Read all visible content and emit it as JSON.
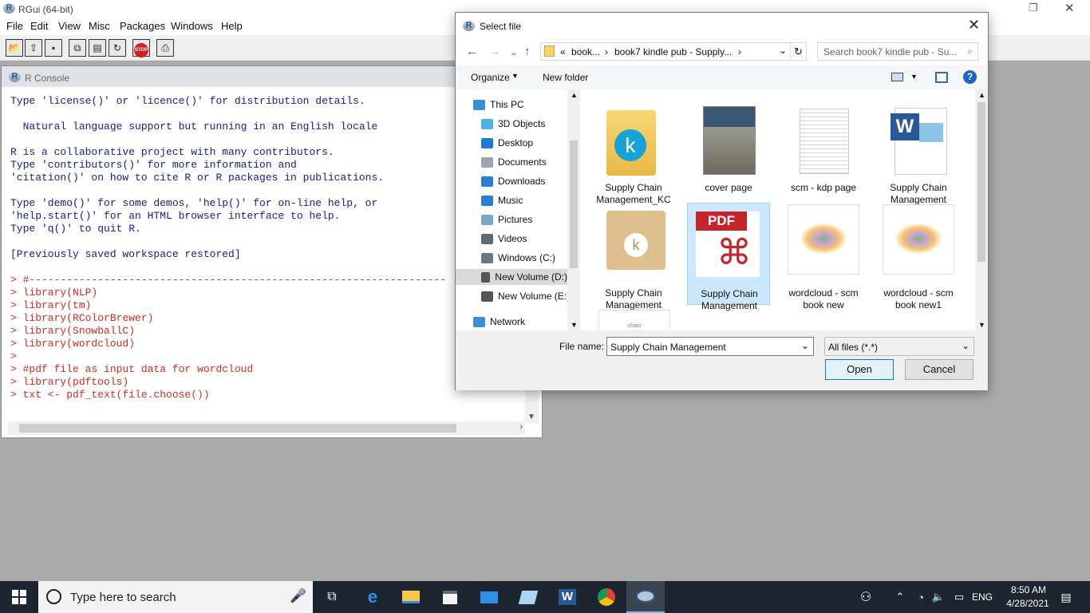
{
  "app": {
    "title": "RGui (64-bit)",
    "logo_letter": "R",
    "window_controls": {
      "restore": "❐",
      "close": "✕"
    }
  },
  "menu": [
    "File",
    "Edit",
    "View",
    "Misc",
    "Packages",
    "Windows",
    "Help"
  ],
  "toolbar": {
    "stop_label": "STOP"
  },
  "console": {
    "title": "R Console",
    "lines_info": [
      "Type 'license()' or 'licence()' for distribution details.",
      "",
      "  Natural language support but running in an English locale",
      "",
      "R is a collaborative project with many contributors.",
      "Type 'contributors()' for more information and",
      "'citation()' on how to cite R or R packages in publications.",
      "",
      "Type 'demo()' for some demos, 'help()' for on-line help, or",
      "'help.start()' for an HTML browser interface to help.",
      "Type 'q()' to quit R.",
      "",
      "[Previously saved workspace restored]",
      ""
    ],
    "lines_cmd": [
      "> #-------------------------------------------------------------------",
      "> library(NLP)",
      "> library(tm)",
      "> library(RColorBrewer)",
      "> library(SnowballC)",
      "> library(wordcloud)",
      ">",
      "> #pdf file as input data for wordcloud",
      "> library(pdftools)",
      "> txt <- pdf_text(file.choose())"
    ]
  },
  "dialog": {
    "title": "Select file",
    "close": "✕",
    "address": {
      "overflow": "«",
      "crumbs": [
        "book...",
        "book7 kindle pub - Supply..."
      ],
      "sep": "›"
    },
    "search_placeholder": "Search book7 kindle pub - Su...",
    "organize": "Organize",
    "new_folder": "New folder",
    "help": "?",
    "tree": [
      {
        "label": "This PC",
        "color": "#3c8fd6",
        "indent": 0
      },
      {
        "label": "3D Objects",
        "color": "#4eb3e3",
        "indent": 1
      },
      {
        "label": "Desktop",
        "color": "#1e7bd3",
        "indent": 1
      },
      {
        "label": "Documents",
        "color": "#9aa6b3",
        "indent": 1
      },
      {
        "label": "Downloads",
        "color": "#2a7fd4",
        "indent": 1
      },
      {
        "label": "Music",
        "color": "#2a7fd4",
        "indent": 1
      },
      {
        "label": "Pictures",
        "color": "#7fa6c8",
        "indent": 1
      },
      {
        "label": "Videos",
        "color": "#5d6a78",
        "indent": 1
      },
      {
        "label": "Windows (C:)",
        "color": "#6a7684",
        "indent": 1
      },
      {
        "label": "New Volume (D:)",
        "color": "#555",
        "indent": 1,
        "selected": true
      },
      {
        "label": "New Volume (E:)",
        "color": "#555",
        "indent": 1
      },
      {
        "label": "Network",
        "color": "#3c8fd6",
        "indent": 0
      }
    ],
    "files": [
      {
        "label": "Supply Chain Management_KC",
        "kind": "folder"
      },
      {
        "label": "cover page",
        "kind": "cover"
      },
      {
        "label": "scm - kdp page",
        "kind": "text"
      },
      {
        "label": "Supply Chain Management",
        "kind": "word"
      },
      {
        "label": "Supply Chain Management",
        "kind": "kindle"
      },
      {
        "label": "Supply Chain Management",
        "kind": "pdf",
        "selected": true
      },
      {
        "label": "wordcloud - scm book new",
        "kind": "cloud"
      },
      {
        "label": "wordcloud - scm book new1",
        "kind": "cloud"
      }
    ],
    "partial_thumb_text": "chain",
    "file_name_label": "File name:",
    "file_name_value": "Supply Chain Management",
    "filter_value": "All files (*.*)",
    "open": "Open",
    "cancel": "Cancel"
  },
  "taskbar": {
    "search_placeholder": "Type here to search",
    "lang": "ENG",
    "time": "8:50 AM",
    "date": "4/28/2021"
  }
}
